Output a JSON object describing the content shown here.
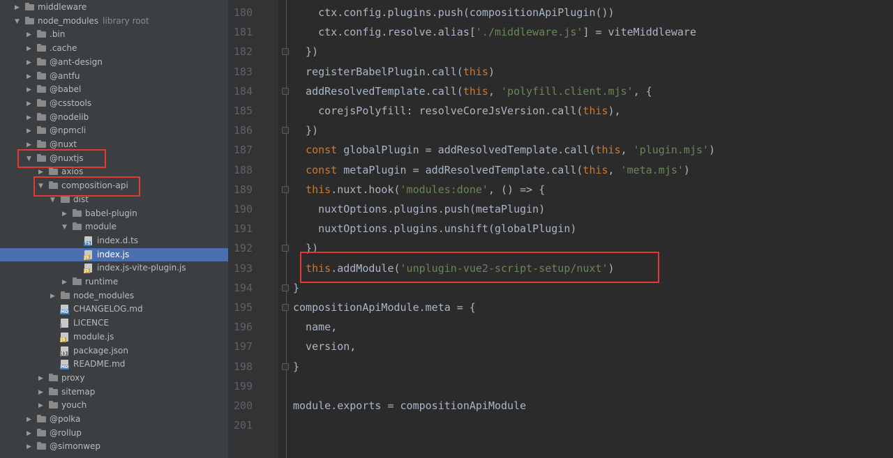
{
  "tree": {
    "rows": [
      {
        "label": "middleware",
        "type": "folder",
        "depth": 1,
        "arrow": "right"
      },
      {
        "label": "node_modules",
        "hint": "library root",
        "type": "folder",
        "depth": 1,
        "arrow": "down"
      },
      {
        "label": ".bin",
        "type": "folder",
        "depth": 2,
        "arrow": "right"
      },
      {
        "label": ".cache",
        "type": "folder",
        "depth": 2,
        "arrow": "right"
      },
      {
        "label": "@ant-design",
        "type": "folder",
        "depth": 2,
        "arrow": "right"
      },
      {
        "label": "@antfu",
        "type": "folder",
        "depth": 2,
        "arrow": "right"
      },
      {
        "label": "@babel",
        "type": "folder",
        "depth": 2,
        "arrow": "right"
      },
      {
        "label": "@csstools",
        "type": "folder",
        "depth": 2,
        "arrow": "right"
      },
      {
        "label": "@nodelib",
        "type": "folder",
        "depth": 2,
        "arrow": "right"
      },
      {
        "label": "@npmcli",
        "type": "folder",
        "depth": 2,
        "arrow": "right"
      },
      {
        "label": "@nuxt",
        "type": "folder",
        "depth": 2,
        "arrow": "right"
      },
      {
        "label": "@nuxtjs",
        "type": "folder",
        "depth": 2,
        "arrow": "down"
      },
      {
        "label": "axios",
        "type": "folder",
        "depth": 3,
        "arrow": "right"
      },
      {
        "label": "composition-api",
        "type": "folder",
        "depth": 3,
        "arrow": "down"
      },
      {
        "label": "dist",
        "type": "folder",
        "depth": 4,
        "arrow": "down"
      },
      {
        "label": "babel-plugin",
        "type": "folder",
        "depth": 5,
        "arrow": "right"
      },
      {
        "label": "module",
        "type": "folder",
        "depth": 5,
        "arrow": "down"
      },
      {
        "label": "index.d.ts",
        "type": "file",
        "tag": "TS",
        "depth": 6
      },
      {
        "label": "index.js",
        "type": "file",
        "tag": "JS",
        "depth": 6,
        "selected": true
      },
      {
        "label": "index.js-vite-plugin.js",
        "type": "file",
        "tag": "JS",
        "depth": 6
      },
      {
        "label": "runtime",
        "type": "folder",
        "depth": 5,
        "arrow": "right"
      },
      {
        "label": "node_modules",
        "type": "folder",
        "depth": 4,
        "arrow": "right"
      },
      {
        "label": "CHANGELOG.md",
        "type": "file",
        "tag": "MD",
        "depth": 4
      },
      {
        "label": "LICENCE",
        "type": "file",
        "tag": "",
        "depth": 4
      },
      {
        "label": "module.js",
        "type": "file",
        "tag": "JS",
        "depth": 4
      },
      {
        "label": "package.json",
        "type": "file",
        "tag": "{}",
        "depth": 4
      },
      {
        "label": "README.md",
        "type": "file",
        "tag": "MD",
        "depth": 4
      },
      {
        "label": "proxy",
        "type": "folder",
        "depth": 3,
        "arrow": "right"
      },
      {
        "label": "sitemap",
        "type": "folder",
        "depth": 3,
        "arrow": "right"
      },
      {
        "label": "youch",
        "type": "folder",
        "depth": 3,
        "arrow": "right"
      },
      {
        "label": "@polka",
        "type": "folder",
        "depth": 2,
        "arrow": "right"
      },
      {
        "label": "@rollup",
        "type": "folder",
        "depth": 2,
        "arrow": "right"
      },
      {
        "label": "@simonwep",
        "type": "folder",
        "depth": 2,
        "arrow": "right"
      }
    ]
  },
  "editor": {
    "lines": [
      {
        "num": "180",
        "fold": false,
        "tokens": [
          [
            "    ctx.config.plugins.push(compositionApiPlugin())",
            "plain"
          ]
        ]
      },
      {
        "num": "181",
        "fold": false,
        "tokens": [
          [
            "    ctx.config.resolve.alias[",
            "plain"
          ],
          [
            "'./middleware.js'",
            "str"
          ],
          [
            "] = viteMiddleware",
            "plain"
          ]
        ]
      },
      {
        "num": "182",
        "fold": true,
        "tokens": [
          [
            "  })",
            "plain"
          ]
        ]
      },
      {
        "num": "183",
        "fold": false,
        "tokens": [
          [
            "  registerBabelPlugin.call(",
            "plain"
          ],
          [
            "this",
            "kw"
          ],
          [
            ")",
            "plain"
          ]
        ]
      },
      {
        "num": "184",
        "fold": true,
        "tokens": [
          [
            "  addResolvedTemplate.call(",
            "plain"
          ],
          [
            "this",
            "kw"
          ],
          [
            ", ",
            "plain"
          ],
          [
            "'polyfill.client.mjs'",
            "str"
          ],
          [
            ", {",
            "plain"
          ]
        ]
      },
      {
        "num": "185",
        "fold": false,
        "tokens": [
          [
            "    corejsPolyfill: resolveCoreJsVersion.call(",
            "plain"
          ],
          [
            "this",
            "kw"
          ],
          [
            "),",
            "plain"
          ]
        ]
      },
      {
        "num": "186",
        "fold": true,
        "tokens": [
          [
            "  })",
            "plain"
          ]
        ]
      },
      {
        "num": "187",
        "fold": false,
        "tokens": [
          [
            "  ",
            "plain"
          ],
          [
            "const",
            "kw"
          ],
          [
            " globalPlugin = addResolvedTemplate.call(",
            "plain"
          ],
          [
            "this",
            "kw"
          ],
          [
            ", ",
            "plain"
          ],
          [
            "'plugin.mjs'",
            "str"
          ],
          [
            ")",
            "plain"
          ]
        ]
      },
      {
        "num": "188",
        "fold": false,
        "tokens": [
          [
            "  ",
            "plain"
          ],
          [
            "const",
            "kw"
          ],
          [
            " metaPlugin = addResolvedTemplate.call(",
            "plain"
          ],
          [
            "this",
            "kw"
          ],
          [
            ", ",
            "plain"
          ],
          [
            "'meta.mjs'",
            "str"
          ],
          [
            ")",
            "plain"
          ]
        ]
      },
      {
        "num": "189",
        "fold": true,
        "tokens": [
          [
            "  ",
            "plain"
          ],
          [
            "this",
            "kw"
          ],
          [
            ".nuxt.hook(",
            "plain"
          ],
          [
            "'modules:done'",
            "str"
          ],
          [
            ", () => {",
            "plain"
          ]
        ]
      },
      {
        "num": "190",
        "fold": false,
        "tokens": [
          [
            "    nuxtOptions.plugins.push(metaPlugin)",
            "plain"
          ]
        ]
      },
      {
        "num": "191",
        "fold": false,
        "tokens": [
          [
            "    nuxtOptions.plugins.unshift(globalPlugin)",
            "plain"
          ]
        ]
      },
      {
        "num": "192",
        "fold": true,
        "tokens": [
          [
            "  })",
            "plain"
          ]
        ]
      },
      {
        "num": "193",
        "fold": false,
        "tokens": [
          [
            "  ",
            "plain"
          ],
          [
            "this",
            "kw"
          ],
          [
            ".addModule(",
            "plain"
          ],
          [
            "'unplugin-vue2-script-setup/nuxt'",
            "str"
          ],
          [
            ")",
            "plain"
          ]
        ]
      },
      {
        "num": "194",
        "fold": true,
        "tokens": [
          [
            "}",
            "plain"
          ]
        ]
      },
      {
        "num": "195",
        "fold": true,
        "tokens": [
          [
            "compositionApiModule.meta = {",
            "plain"
          ]
        ]
      },
      {
        "num": "196",
        "fold": false,
        "tokens": [
          [
            "  name,",
            "plain"
          ]
        ]
      },
      {
        "num": "197",
        "fold": false,
        "tokens": [
          [
            "  version,",
            "plain"
          ]
        ]
      },
      {
        "num": "198",
        "fold": true,
        "tokens": [
          [
            "}",
            "plain"
          ]
        ]
      },
      {
        "num": "199",
        "fold": false,
        "tokens": []
      },
      {
        "num": "200",
        "fold": false,
        "tokens": [
          [
            "module.exports = compositionApiModule",
            "plain"
          ]
        ]
      },
      {
        "num": "201",
        "fold": false,
        "tokens": []
      }
    ]
  }
}
